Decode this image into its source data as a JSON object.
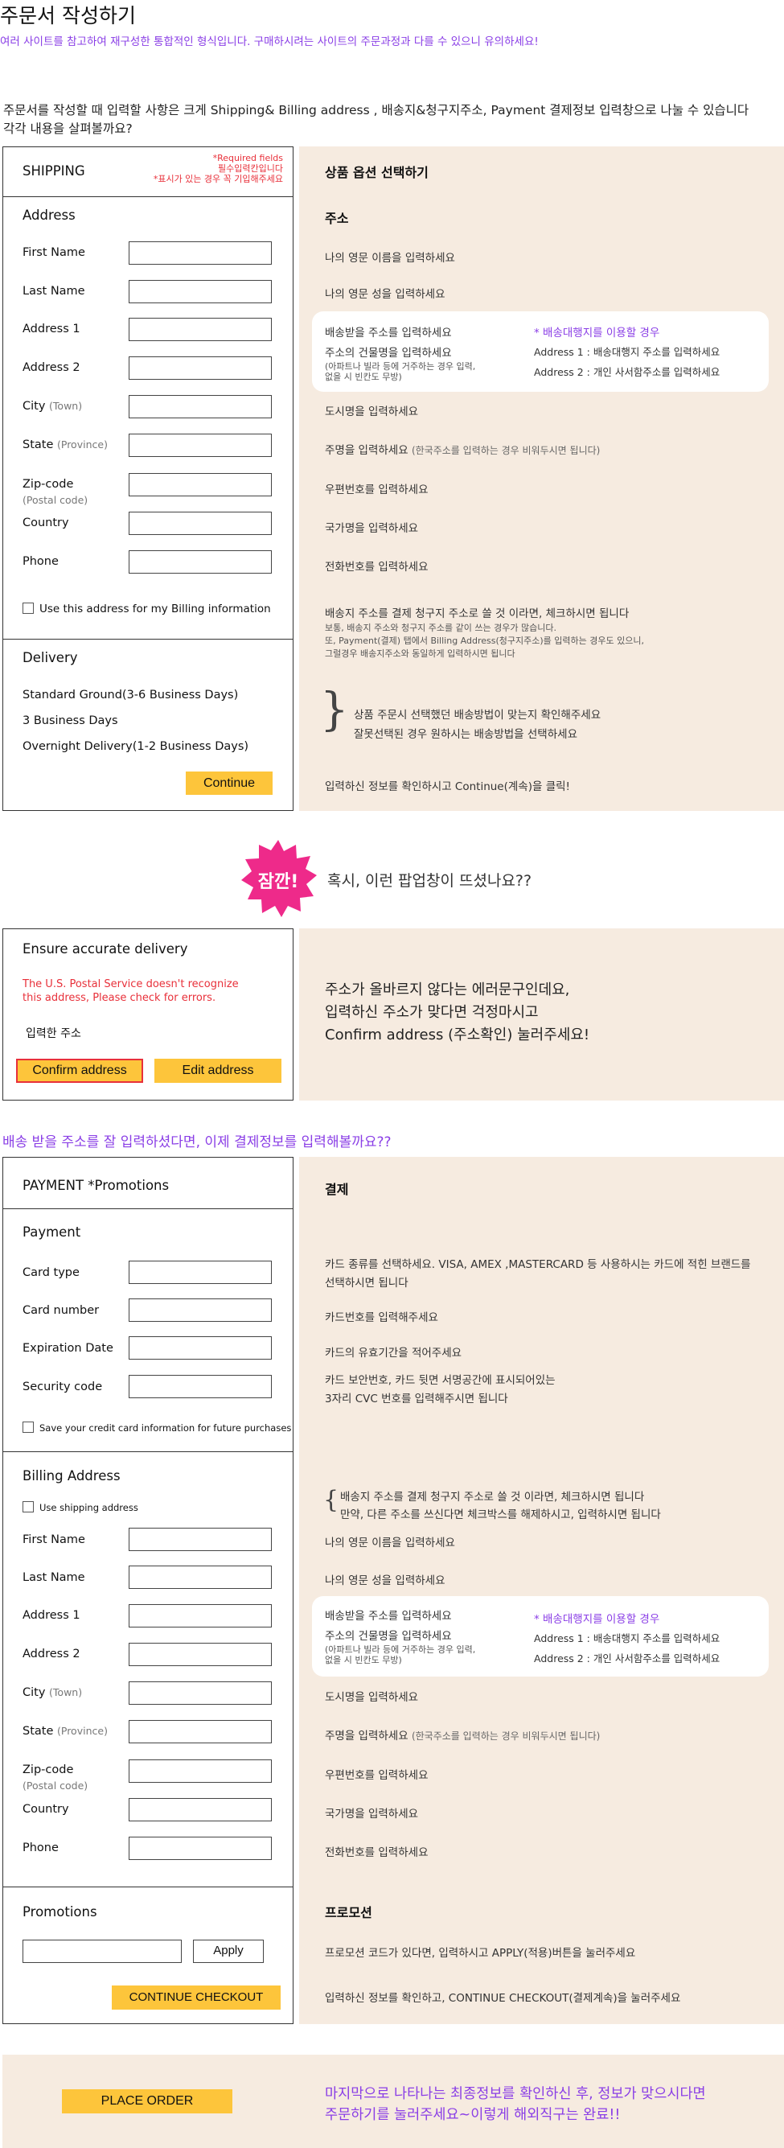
{
  "header": {
    "title": "주문서 작성하기",
    "notice": "여러 사이트를 참고하여 재구성한 통합적인 형식입니다. 구매하시려는 사이트의 주문과정과 다를 수 있으니 유의하세요!",
    "intro_line1": "주문서를  작성할 때 입력할 사항은 크게 Shipping& Billing address , 배송지&청구지주소, Payment 결제정보 입력창으로 나눌 수 있습니다",
    "intro_line2": "각각 내용을 살펴볼까요?"
  },
  "shipping": {
    "title": "SHIPPING",
    "required1": "*Required fields",
    "required2": "필수입력칸입니다",
    "required3": "*표시가 있는 경우 꼭 기입해주세요",
    "address_title": "Address",
    "fields": {
      "first": "First Name",
      "last": "Last Name",
      "addr1": "Address 1",
      "addr2": "Address 2",
      "city": "City",
      "city_sub": "(Town)",
      "state": "State",
      "state_sub": "(Province)",
      "zip": "Zip-code",
      "zip_sub": "(Postal code)",
      "country": "Country",
      "phone": "Phone"
    },
    "billing_check": "Use this address for my Billing information",
    "delivery_title": "Delivery",
    "delivery_options": [
      "Standard Ground(3-6 Business Days)",
      "3 Business Days",
      "Overnight Delivery(1-2 Business Days)"
    ],
    "continue": "Continue"
  },
  "shipping_notes": {
    "heading": "상품 옵션 선택하기",
    "address_heading": "주소",
    "first": "나의 영문 이름을 입력하세요",
    "last": "나의 영문 성을 입력하세요",
    "addr1": "배송받을 주소를 입력하세요",
    "addr2": "주소의 건물명을 입력하세요",
    "addr_tip1": "(아파트나 빌라 등에 거주하는 경우 입력,",
    "addr_tip2": "없을 시 빈칸도 무방)",
    "agent_title": "* 배송대행지를 이용할 경우",
    "agent1": "Address 1 : 배송대행지 주소를 입력하세요",
    "agent2": "Address 2 : 개인 사서함주소를 입력하세요",
    "city": "도시명을 입력하세요",
    "state": "주명을 입력하세요",
    "state_sub": "(한국주소를 입력하는 경우 비워두시면 됩니다)",
    "zip": "우편번호를 입력하세요",
    "country": "국가명을 입력하세요",
    "phone": "전화번호를 입력하세요",
    "billing1": "배송지 주소를 결제 청구지 주소로 쓸 것 이라면, 체크하시면 됩니다",
    "billing2": "보통, 배송지 주소와 청구지 주소를 같이 쓰는 경우가 많습니다.",
    "billing3": "또, Payment(결제) 탭에서 Billing Address(청구지주소)를 입력하는 경우도 있으니,",
    "billing4": "그럴경우 배송지주소와 동일하게 입력하시면 됩니다",
    "delivery1": "상품 주문시 선택했던 배송방법이 맞는지 확인해주세요",
    "delivery2": "잘못선택된 경우 원하시는 배송방법을 선택하세요",
    "continue_note": "입력하신 정보를 확인하시고 Continue(계속)을 클릭!"
  },
  "popup_intro": {
    "badge": "잠깐!",
    "text": "혹시, 이런 팝업창이 뜨셨나요??"
  },
  "popup": {
    "title": "Ensure accurate delivery",
    "error1": "The U.S. Postal Service doesn't recognize",
    "error2": "this address, Please check for errors.",
    "entered": "입력한 주소",
    "confirm": "Confirm address",
    "edit": "Edit address",
    "note1": "주소가 올바르지 않다는 에러문구인데요,",
    "note2": "입력하신 주소가 맞다면 걱정마시고",
    "note3": "Confirm address (주소확인) 눌러주세요!"
  },
  "payment_intro": "배송 받을 주소를 잘 입력하셨다면, 이제 결제정보를 입력해볼까요??",
  "payment": {
    "title": "PAYMENT  *Promotions",
    "payment_title": "Payment",
    "card_type": "Card type",
    "card_number": "Card number",
    "expiration": "Expiration Date",
    "security": "Security code",
    "save_card": "Save your credit card information for future purchases",
    "billing_title": "Billing Address",
    "use_shipping": "Use shipping address",
    "promotions_title": "Promotions",
    "apply": "Apply",
    "checkout": "CONTINUE CHECKOUT"
  },
  "payment_notes": {
    "heading": "결제",
    "card_type1": "카드 종류를 선택하세요. VISA, AMEX ,MASTERCARD 등 사용하시는 카드에 적힌 브랜드를",
    "card_type2": "선택하시면 됩니다",
    "card_number": "카드번호를 입력해주세요",
    "expiration": "카드의 유효기간을 적어주세요",
    "security1": "카드 보안번호, 카드 뒷면 서명공간에 표시되어있는",
    "security2": "3자리 CVC 번호를 입력해주시면 됩니다",
    "billing1": "배송지 주소를 결제 청구지 주소로 쓸 것 이라면, 체크하시면 됩니다",
    "billing2": "만약, 다른 주소를 쓰신다면 체크박스를 해제하시고, 입력하시면 됩니다",
    "promo_heading": "프로모션",
    "promo": "프로모션 코드가 있다면, 입력하시고 APPLY(적용)버튼을 눌러주세요",
    "checkout": "입력하신 정보를 확인하고, CONTINUE CHECKOUT(결제계속)을 눌러주세요"
  },
  "final": {
    "place_order": "PLACE ORDER",
    "note1": "마지막으로 나타나는 최종정보를 확인하신 후, 정보가 맞으시다면",
    "note2": "주문하기를 눌러주세요~이렇게 해외직구는 완료!!"
  }
}
